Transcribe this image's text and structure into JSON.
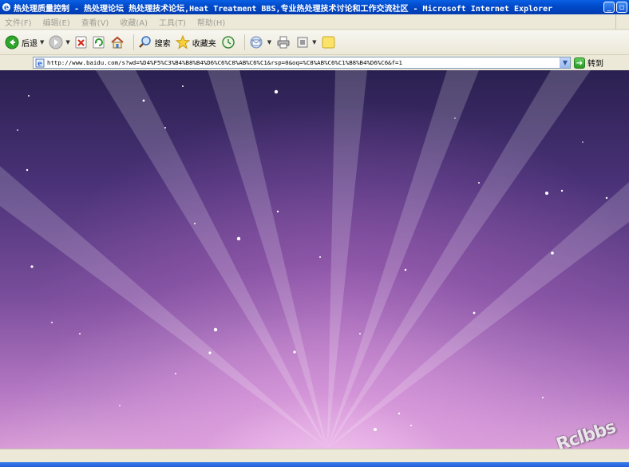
{
  "window": {
    "title": "热处理质量控制 - 热处理论坛 热处理技术论坛,Heat Treatment BBS,专业热处理技术讨论和工作交流社区 - Microsoft Internet Explorer",
    "minimize_glyph": "_",
    "restore_glyph": "▫"
  },
  "menu": [
    {
      "label": "文件(F)"
    },
    {
      "label": "编辑(E)"
    },
    {
      "label": "查看(V)"
    },
    {
      "label": "收藏(A)"
    },
    {
      "label": "工具(T)"
    },
    {
      "label": "帮助(H)"
    }
  ],
  "toolbar": {
    "back_label": "后退",
    "search_label": "搜索",
    "favorites_label": "收藏夹"
  },
  "address": {
    "url": "http://www.baidu.com/s?wd=%D4%F5%C3%B4%B8%B4%D6%C6%C8%AB%C6%C1&rsp=0&oq=%C8%AB%C6%C1%B8%B4%D6%C6&f=1",
    "go_label": "转到"
  },
  "content": {
    "watermark": "Rclbbs"
  },
  "colors": {
    "titlebar": "#0049c9",
    "chrome": "#ece9d8",
    "wallpaper_top": "#2a2050",
    "wallpaper_bottom": "#d89ad6"
  },
  "icons": [
    "ie-icon",
    "back-icon",
    "forward-icon",
    "stop-icon",
    "refresh-icon",
    "home-icon",
    "search-icon",
    "favorites-star-icon",
    "history-icon",
    "mail-icon",
    "print-icon",
    "edit-icon",
    "messenger-note-icon",
    "page-icon",
    "go-arrow-icon"
  ]
}
